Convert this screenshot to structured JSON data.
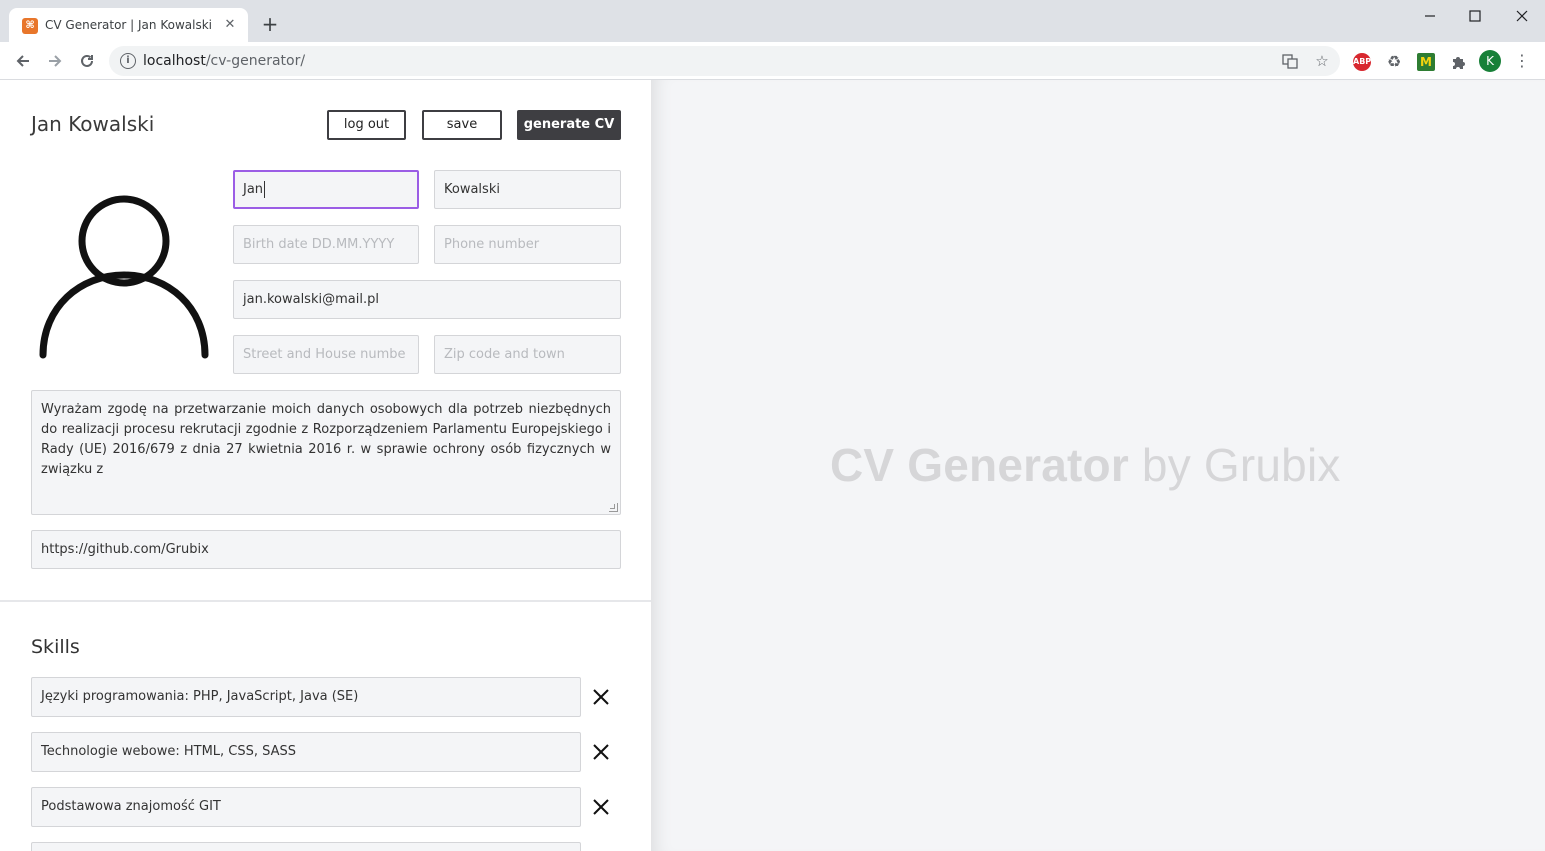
{
  "browser": {
    "tab_title": "CV Generator | Jan Kowalski",
    "tab_favicon_glyph": "⌘",
    "url_host": "localhost",
    "url_path": "/cv-generator/",
    "profile_initial": "K",
    "extensions": [
      "ABP",
      "M"
    ]
  },
  "header": {
    "title": "Jan Kowalski",
    "logout_label": "log out",
    "save_label": "save",
    "generate_label": "generate CV"
  },
  "form": {
    "first_name": {
      "value": "Jan"
    },
    "last_name": {
      "value": "Kowalski"
    },
    "birth_date": {
      "placeholder": "Birth date DD.MM.YYYY"
    },
    "phone": {
      "placeholder": "Phone number"
    },
    "email": {
      "value": "jan.kowalski@mail.pl"
    },
    "street": {
      "placeholder": "Street and House numbe"
    },
    "zip": {
      "placeholder": "Zip code and town"
    },
    "consent": "Wyrażam zgodę na przetwarzanie moich danych osobowych dla potrzeb niezbędnych do realizacji procesu rekrutacji zgodnie z Rozporządzeniem Parlamentu Europejskiego i Rady (UE) 2016/679 z dnia 27 kwietnia 2016 r. w sprawie ochrony osób fizycznych w związku z",
    "github": {
      "value": "https://github.com/Grubix"
    }
  },
  "skills": {
    "heading": "Skills",
    "items": [
      {
        "value": "Języki programowania: PHP, JavaScript, Java (SE)"
      },
      {
        "value": "Technologie webowe: HTML, CSS, SASS"
      },
      {
        "value": "Podstawowa znajomość GIT"
      },
      {
        "value": ""
      }
    ]
  },
  "preview": {
    "brand_strong": "CV Generator",
    "brand_light": " by Grubix"
  },
  "colors": {
    "accent_focus": "#9b5de5",
    "button_dark": "#3e3e42",
    "field_bg": "#f4f5f7",
    "brand_text": "#d6d6d8"
  },
  "icons": [
    "avatar-placeholder-icon",
    "close-icon",
    "info-icon",
    "star-icon",
    "translate-icon",
    "puzzle-icon"
  ]
}
